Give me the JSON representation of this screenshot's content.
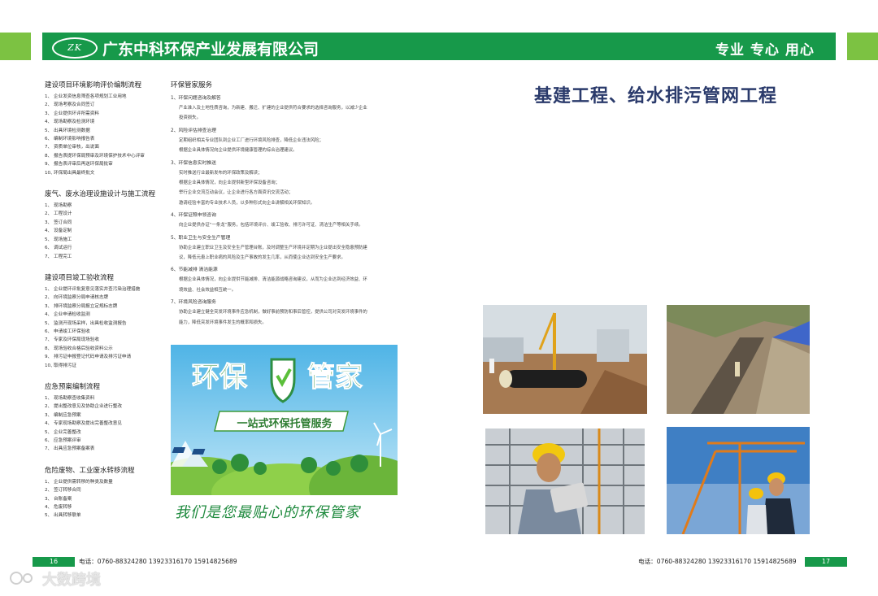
{
  "header": {
    "logo_text": "ZK",
    "company": "广东中科环保产业发展有限公司",
    "slogan": "专业 专心 用心"
  },
  "left_sections": [
    {
      "title": "建设项目环境影响评价编制流程",
      "items": [
        "企业发资信息筛查各项规划工业用地",
        "现场考察及合同签订",
        "企业提供环评所需资料",
        "现场勘察及检测环境",
        "出具环境检测数据",
        "编制环境影响报告表",
        "资质单位审核，出说面",
        "报告表提环保局预审及环境保护技术中心评审",
        "报告表评审后再送环保局批审",
        "环保局出具最终批文"
      ]
    },
    {
      "title": "废气、废水治理设施设计与施工流程",
      "items": [
        "现场勘察",
        "工程设计",
        "签订合同",
        "设备定制",
        "现场施工",
        "调试运行",
        "工程完工"
      ]
    },
    {
      "title": "建设项目竣工验收流程",
      "items": [
        "企业提环评批复意见落实并查污染治理措施",
        "向环境监察分局申请核志牌",
        "排环境监察分局报立定规标志牌",
        "企业申请检收监测",
        "监测开现场采样，出具检收监测报告",
        "申请竣工环保验收",
        "专家及环保局现场验收",
        "现场验收合格后验收资料公示",
        "排污证申报登记代码申请及排污证申请",
        "取得排污证"
      ]
    },
    {
      "title": "应急预案编制流程",
      "items": [
        "现场勘察查收集资料",
        "提出整改意见及协助企业进行整改",
        "编制应急预案",
        "专家现场勘察及提出完善整改意见",
        "企业完善整改",
        "应急预案评审",
        "出具应急预案备案表"
      ]
    },
    {
      "title": "危险废物、工业废水转移流程",
      "items": [
        "企业提供需转移的种类及数量",
        "签订转移合同",
        "台账备案",
        "危废转移",
        "出具转移联单"
      ]
    }
  ],
  "services": {
    "title": "环保管家服务",
    "items": [
      {
        "head": "环保问题咨询及解答",
        "lines": [
          "产业准入及土地性质咨询，为新建、搬迁、扩建的企业提供符合要求的选择咨询服务，以减少企业",
          "投资损失。"
        ]
      },
      {
        "head": "风险评估排查治理",
        "lines": [
          "定期组织相关专业团队到企业工厂进行环境风险排查，降低企业违法风险；",
          "根据企业具体情况向企业提供环境健康管理的综合治理建议。"
        ]
      },
      {
        "head": "环保信息实时推送",
        "lines": [
          "实时推送行业最新发布的环保政策及解读；",
          "根据企业具体情况，向企业提供新型环保设备咨询；",
          "举行企业交流互动会议，让企业进行各方面资讯交流活动；",
          "邀请经验丰富的专业技术人员，以多种形式向企业讲解相关环保知识。"
        ]
      },
      {
        "head": "环保证照申领咨询",
        "lines": [
          "向企业提供办证“一条龙”服务，包括环境评价、竣工验收、排污许可证、清洁生产等相关手续。"
        ]
      },
      {
        "head": "职业卫生与安全生产管理",
        "lines": [
          "协助企业建立职业卫生及安全生产管理台账，及时调整生产环境并定期为企业提出安全隐患预防建",
          "议，降低元患上职业病的风险及生产事故的发生几率，从而使企业达到安全生产要求。"
        ]
      },
      {
        "head": "节能减排 清洁能源",
        "lines": [
          "根据企业具体情况，向企业提供节能减排、清洁能源战略咨询建议，从而为企业达到经济效益、环",
          "境效益、社会效益相互统一。"
        ]
      },
      {
        "head": "环境风险咨询服务",
        "lines": [
          "协助企业建立健全突发环境事件应急机制，做好事前预防和事后管控，提供公司对突发环境事件的",
          "能力，降低突发环境事件发生的概率和损失。"
        ]
      }
    ]
  },
  "banner": {
    "title_a": "环保",
    "title_b": "管家",
    "ribbon": "一站式环保托管服务"
  },
  "handwritten_slogan": "我们是您最贴心的环保管家",
  "right_page": {
    "title": "基建工程、给水排污管网工程"
  },
  "footer": {
    "page_left": "16",
    "page_right": "17",
    "phone": "电话：0760-88324280  13923316170  15914825689"
  },
  "watermark": "大数跨境"
}
